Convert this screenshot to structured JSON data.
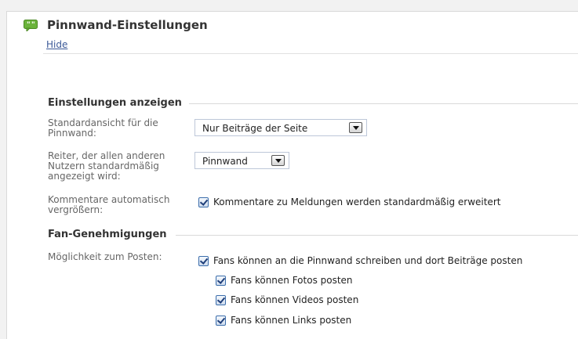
{
  "header": {
    "icon": "speech-bubble-icon",
    "title": "Pinnwand-Einstellungen",
    "hide_label": "Hide"
  },
  "sections": {
    "display": {
      "title": "Einstellungen anzeigen",
      "default_view": {
        "label_line1": "Standardansicht für die",
        "label_line2": "Pinnwand:",
        "selected": "Nur Beiträge der Seite"
      },
      "default_tab": {
        "label_line1": "Reiter, der allen anderen",
        "label_line2": "Nutzern standardmäßig",
        "label_line3": "angezeigt wird:",
        "selected": "Pinnwand"
      },
      "auto_expand": {
        "label_line1": "Kommentare automatisch",
        "label_line2": "vergrößern:",
        "checkbox_label": "Kommentare zu Meldungen werden standardmäßig erweitert",
        "checked": true
      }
    },
    "fan_permissions": {
      "title": "Fan-Genehmigungen",
      "posting_label": "Möglichkeit zum Posten:",
      "main_option": {
        "label": "Fans können an die Pinnwand schreiben und dort Beiträge posten",
        "checked": true
      },
      "sub_options": [
        {
          "label": "Fans können Fotos posten",
          "checked": true
        },
        {
          "label": "Fans können Videos posten",
          "checked": true
        },
        {
          "label": "Fans können Links posten",
          "checked": true
        }
      ]
    }
  },
  "colors": {
    "link": "#3b5998",
    "icon_green": "#6bb33b"
  }
}
